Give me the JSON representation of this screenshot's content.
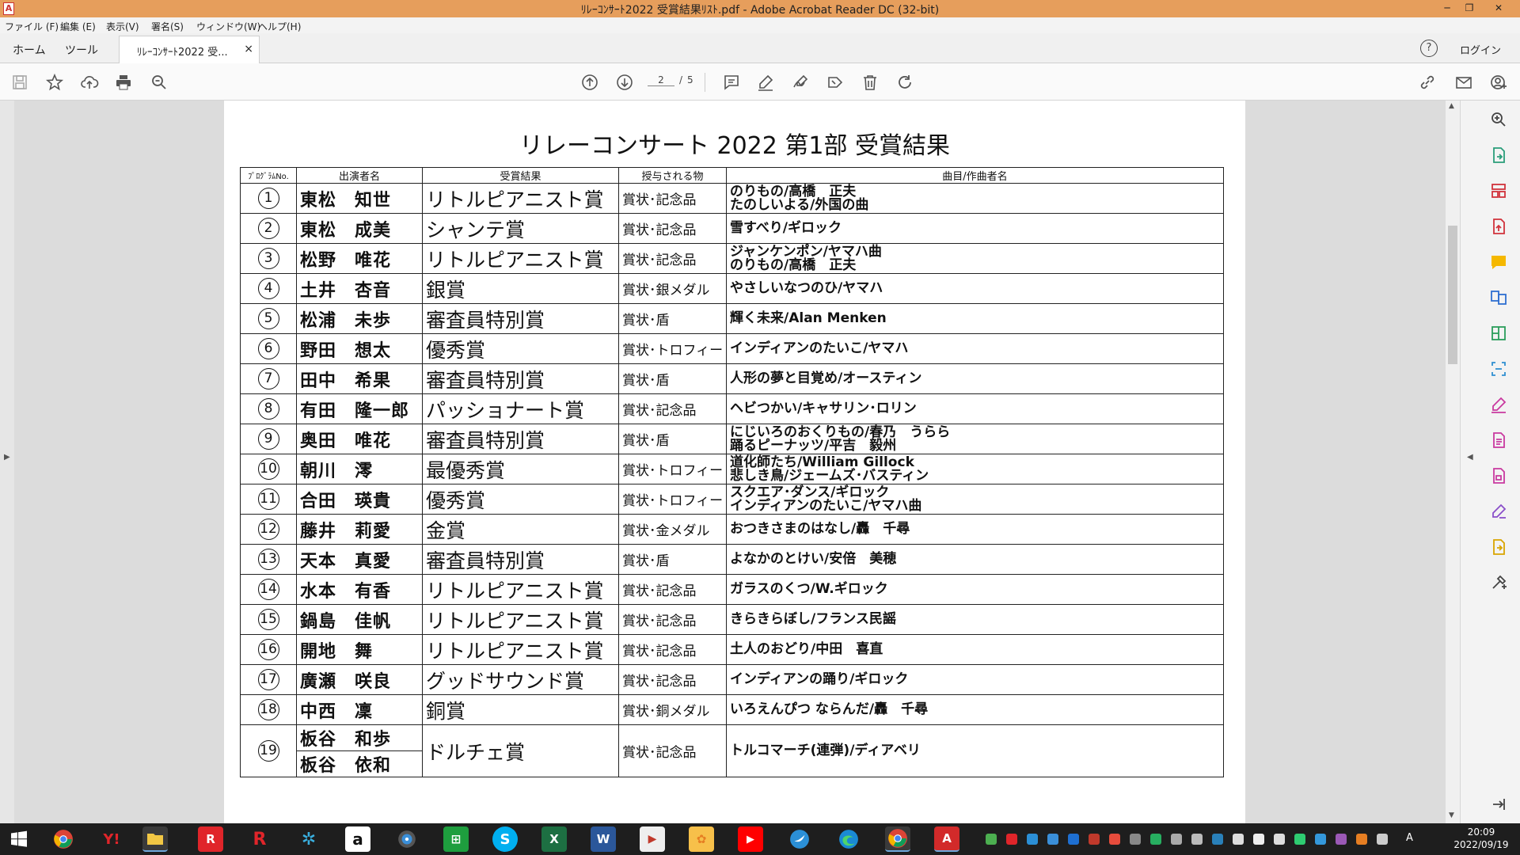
{
  "window": {
    "title": "ﾘﾚｰｺﾝｻｰﾄ2022  受賞結果ﾘｽﾄ.pdf - Adobe Acrobat Reader DC (32-bit)",
    "minimize": "─",
    "restore": "❐",
    "close": "✕"
  },
  "menu": [
    "ファイル (F)",
    "編集 (E)",
    "表示(V)",
    "署名(S)",
    "ウィンドウ(W)",
    "ヘルプ(H)"
  ],
  "tabs": {
    "home": "ホーム",
    "tools": "ツール",
    "document": "ﾘﾚｰｺﾝｻｰﾄ2022  受...",
    "close": "×",
    "help": "?",
    "login": "ログイン"
  },
  "toolbar": {
    "page_current": "2",
    "page_separator": "/",
    "page_total": "5"
  },
  "document": {
    "title": "リレーコンサート 2022   第1部   受賞結果",
    "headers": {
      "program": "ﾌﾟﾛｸﾞﾗﾑNo.",
      "performer": "出演者名",
      "award": "受賞結果",
      "prize": "授与される物",
      "piece": "曲目/作曲者名"
    },
    "rows": [
      {
        "num": "1",
        "performer": "東松　知世",
        "award": "リトルピアニスト賞",
        "prize": "賞状･記念品",
        "piece": [
          "のりもの/高橋　正夫",
          "たのしいよる/外国の曲"
        ]
      },
      {
        "num": "2",
        "performer": "東松　成美",
        "award": "シャンテ賞",
        "prize": "賞状･記念品",
        "piece": [
          "雪すべり/ギロック"
        ]
      },
      {
        "num": "3",
        "performer": "松野　唯花",
        "award": "リトルピアニスト賞",
        "prize": "賞状･記念品",
        "piece": [
          "ジャンケンポン/ヤマハ曲",
          "のりもの/高橋　正夫"
        ]
      },
      {
        "num": "4",
        "performer": "土井　杏音",
        "award": "銀賞",
        "prize": "賞状･銀メダル",
        "piece": [
          "やさしいなつのひ/ヤマハ"
        ]
      },
      {
        "num": "5",
        "performer": "松浦　未歩",
        "award": "審査員特別賞",
        "prize": "賞状･盾",
        "piece": [
          "輝く未来/Alan Menken"
        ]
      },
      {
        "num": "6",
        "performer": "野田　想太",
        "award": "優秀賞",
        "prize": "賞状･トロフィー",
        "piece": [
          "インディアンのたいこ/ヤマハ"
        ]
      },
      {
        "num": "7",
        "performer": "田中　希果",
        "award": "審査員特別賞",
        "prize": "賞状･盾",
        "piece": [
          "人形の夢と目覚め/オースティン"
        ]
      },
      {
        "num": "8",
        "performer": "有田　隆一郎",
        "award": "パッショナート賞",
        "prize": "賞状･記念品",
        "piece": [
          "ヘビつかい/キャサリン･ロリン"
        ]
      },
      {
        "num": "9",
        "performer": "奥田　唯花",
        "award": "審査員特別賞",
        "prize": "賞状･盾",
        "piece": [
          "にじいろのおくりもの/春乃　うらら",
          "踊るピーナッツ/平吉　毅州"
        ]
      },
      {
        "num": "10",
        "performer": "朝川　澪",
        "award": "最優秀賞",
        "prize": "賞状･トロフィー",
        "piece": [
          "道化師たち/William Gillock",
          "悲しき鳥/ジェームズ･バスティン"
        ]
      },
      {
        "num": "11",
        "performer": "合田　瑛貴",
        "award": "優秀賞",
        "prize": "賞状･トロフィー",
        "piece": [
          "スクエア･ダンス/ギロック",
          "インディアンのたいこ/ヤマハ曲"
        ]
      },
      {
        "num": "12",
        "performer": "藤井　莉愛",
        "award": "金賞",
        "prize": "賞状･金メダル",
        "piece": [
          "おつきさまのはなし/轟　千尋"
        ]
      },
      {
        "num": "13",
        "performer": "天本　真愛",
        "award": "審査員特別賞",
        "prize": "賞状･盾",
        "piece": [
          "よなかのとけい/安倍　美穂"
        ]
      },
      {
        "num": "14",
        "performer": "水本　有香",
        "award": "リトルピアニスト賞",
        "prize": "賞状･記念品",
        "piece": [
          "ガラスのくつ/W.ギロック"
        ]
      },
      {
        "num": "15",
        "performer": "鍋島　佳帆",
        "award": "リトルピアニスト賞",
        "prize": "賞状･記念品",
        "piece": [
          "きらきらぼし/フランス民謡"
        ]
      },
      {
        "num": "16",
        "performer": "開地　舞",
        "award": "リトルピアニスト賞",
        "prize": "賞状･記念品",
        "piece": [
          "土人のおどり/中田　喜直"
        ]
      },
      {
        "num": "17",
        "performer": "廣瀬　咲良",
        "award": "グッドサウンド賞",
        "prize": "賞状･記念品",
        "piece": [
          "インディアンの踊り/ギロック"
        ]
      },
      {
        "num": "18",
        "performer": "中西　凜",
        "award": "銅賞",
        "prize": "賞状･銅メダル",
        "piece": [
          "いろえんぴつ ならんだ/轟　千尋"
        ]
      }
    ],
    "last_row": {
      "num": "19",
      "performer_1": "板谷　和歩",
      "performer_2": "板谷　依和",
      "award": "ドルチェ賞",
      "prize": "賞状･記念品",
      "piece": "トルコマーチ(連弾)/ディアベリ"
    }
  },
  "taskbar": {
    "clock_time": "20:09",
    "clock_date": "2022/09/19",
    "ime": "A"
  }
}
